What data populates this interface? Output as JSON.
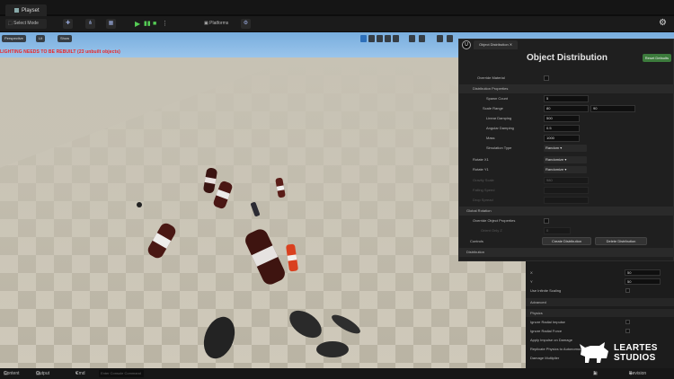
{
  "editor": {
    "map_tab": "Playset",
    "toolbar": {
      "mode": "Select Mode",
      "platforms": "Platforms"
    }
  },
  "viewport": {
    "perspective": "Perspective",
    "lit": "Lit",
    "show": "Show",
    "warning": "LIGHTING NEEDS TO BE REBUILT (23 unbuilt objects)"
  },
  "panel": {
    "tab": "Object Distribution",
    "title": "Object Distribution",
    "badge": "Reset Defaults",
    "rows": {
      "override_material": "Override Material",
      "distribution_properties": "Distribution Properties",
      "spawn_count": "Spawn Count",
      "spawn_count_val": "5",
      "scale_range": "Scale Range",
      "scale_min": "80",
      "scale_max": "90",
      "linear_damping": "Linear Damping",
      "linear_damping_val": "500",
      "angular_damping": "Angular Damping",
      "angular_damping_val": "0.5",
      "mass": "Mass",
      "mass_val": "1000",
      "simulation_type": "Simulation Type",
      "simulation_type_val": "Random",
      "rot_x": "Rotate X1",
      "rot_x_val": "Randomize",
      "rot_y": "Rotate Y1",
      "rot_y_val": "Randomize",
      "gravity": "Gravity Scale",
      "gravity_val": "980",
      "dim1": "Falling Speed",
      "dim2": "Drop Spread",
      "global_rotation": "Global Rotation",
      "override_obj_props": "Override Object Properties",
      "orient_only": "Orient Only Z",
      "orient_val": "0",
      "controls": "Controls",
      "create_btn": "Create Distribution",
      "delete_btn": "Delete Distribution"
    }
  },
  "details": {
    "distribution": "Distribution",
    "x": "X",
    "x_val": "50",
    "y": "Y",
    "y_val": "50",
    "use_infinite": "Use Infinite Scaling",
    "advanced": "Advanced",
    "physics": "Physics",
    "ignore_radial_impulse": "Ignore Radial Impulse",
    "ignore_radial_force": "Ignore Radial Force",
    "apply_impulse": "Apply Impulse on Damage",
    "replicate": "Replicate Physics to Autonomous",
    "damage": "Damage Multiplier"
  },
  "statusbar": {
    "content_drawer": "Content Drawer",
    "output_log": "Output Log",
    "cmd": "Cmd",
    "cmd_placeholder": "Enter Console Command",
    "unsaved": "1 Unsaved",
    "revision": "Revision Control"
  },
  "logo": {
    "line1": "LEARTES",
    "line2": "STUDIOS"
  }
}
